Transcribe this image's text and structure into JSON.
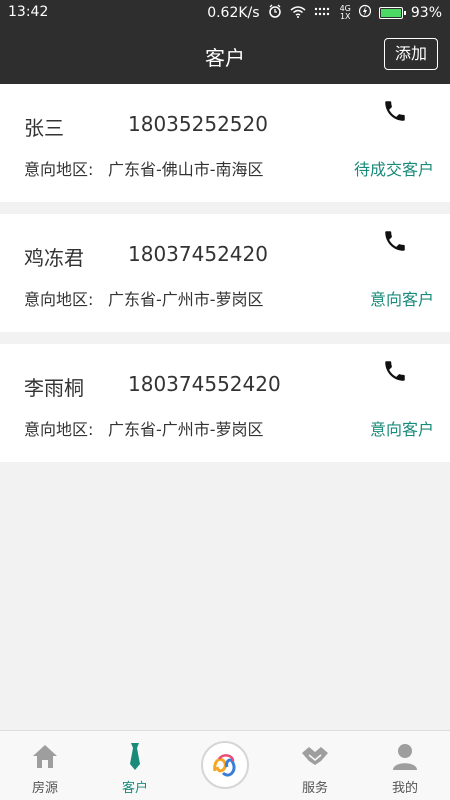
{
  "status_bar": {
    "time": "13:42",
    "network_speed": "0.62K/s",
    "signal_top": "4G",
    "signal_bottom": "1X",
    "battery_text": "93%",
    "battery_level": 0.93
  },
  "nav": {
    "title": "客户",
    "add_label": "添加"
  },
  "customers": [
    {
      "name": "张三",
      "phone": "18035252520",
      "area_label": "意向地区:",
      "area": "广东省-佛山市-南海区",
      "status": "待成交客户"
    },
    {
      "name": "鸡冻君",
      "phone": "18037452420",
      "area_label": "意向地区:",
      "area": "广东省-广州市-萝岗区",
      "status": "意向客户"
    },
    {
      "name": "李雨桐",
      "phone": "180374552420",
      "area_label": "意向地区:",
      "area": "广东省-广州市-萝岗区",
      "status": "意向客户"
    }
  ],
  "tabs": [
    {
      "label": "房源",
      "icon": "house-icon"
    },
    {
      "label": "客户",
      "icon": "tie-icon",
      "active": true
    },
    {
      "label": "",
      "icon": "app-logo-icon"
    },
    {
      "label": "服务",
      "icon": "handshake-icon"
    },
    {
      "label": "我的",
      "icon": "person-icon"
    }
  ],
  "colors": {
    "header_bg": "#2e2e2e",
    "accent": "#1a8a7a"
  }
}
